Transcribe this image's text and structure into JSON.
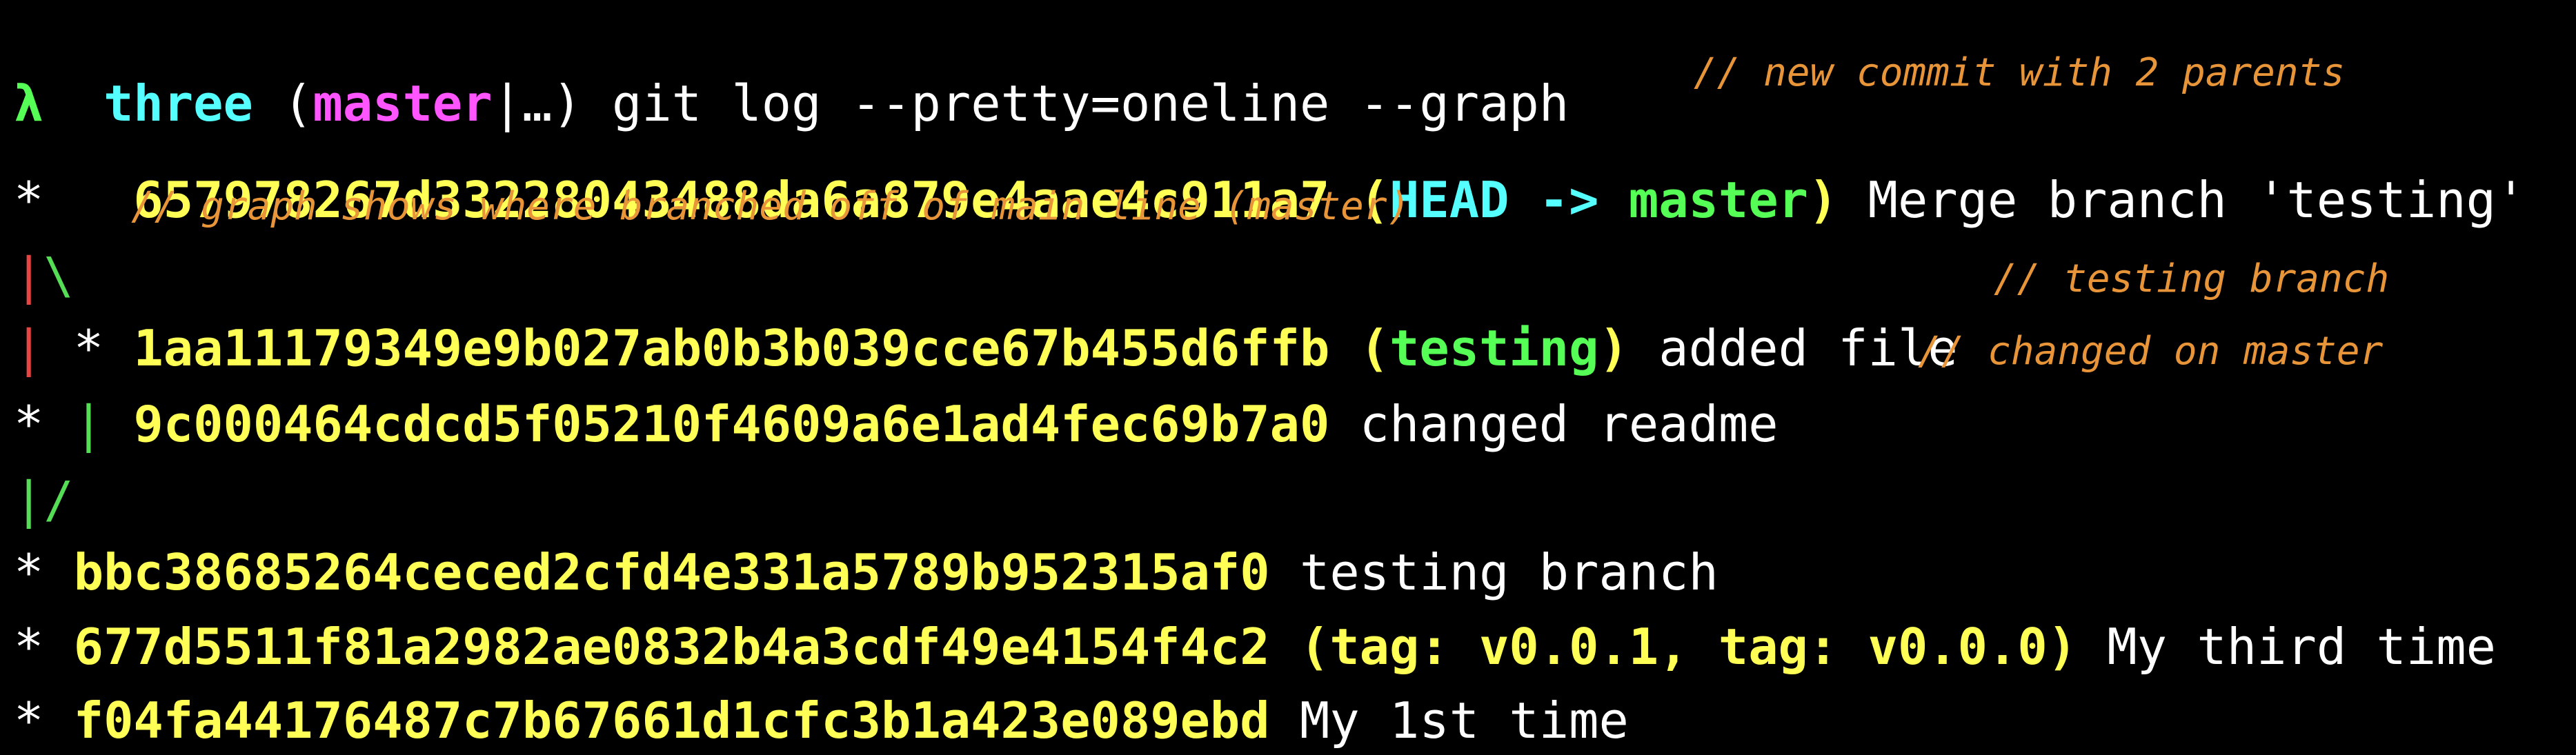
{
  "prompt": {
    "lambda": "λ",
    "directory": "three",
    "open_paren": "(",
    "branch": "master",
    "status": "|…",
    "close_paren": ")",
    "command": "git log --pretty=oneline --graph"
  },
  "annotations": {
    "merge": "// new commit with 2 parents",
    "branched": "// graph shows where branched off of main line (master)",
    "testing": "// testing branch",
    "master": "// changed on master"
  },
  "log": [
    {
      "graph": "*",
      "hash": "657978267d33228043488da6a879e4aae4c911a7",
      "refs_open": "(",
      "ref_head": "HEAD",
      "ref_arrow": "->",
      "ref_branch": "master",
      "refs_close": ")",
      "message": "Merge branch 'testing'"
    },
    {
      "graph_pipe": "|",
      "graph_backslash": "\\"
    },
    {
      "graph_pipe": "|",
      "graph_star": "*",
      "hash": "1aa11179349e9b027ab0b3b039cce67b455d6ffb",
      "refs_open": "(",
      "ref_branch": "testing",
      "refs_close": ")",
      "message": "added file"
    },
    {
      "graph_star": "*",
      "graph_pipe": "|",
      "hash": "9c000464cdcd5f05210f4609a6e1ad4fec69b7a0",
      "message": "changed readme"
    },
    {
      "graph_slash": "|/"
    },
    {
      "graph": "*",
      "hash": "bbc38685264ceced2cfd4e331a5789b952315af0",
      "message": "testing branch"
    },
    {
      "graph": "*",
      "hash": "677d5511f81a2982ae0832b4a3cdf49e4154f4c2",
      "tags": "(tag: v0.0.1, tag: v0.0.0)",
      "message": "My third time"
    },
    {
      "graph": "*",
      "hash": "f04fa44176487c7b67661d1cfc3b1a423e089ebd",
      "message": "My 1st time"
    }
  ],
  "colors": {
    "background": "#000000",
    "hash": "#ffff55",
    "head": "#55ffff",
    "branch": "#55ff55",
    "prompt_branch": "#ff55ff",
    "graph_left": "#e94444",
    "graph_right": "#55dd55",
    "comment": "#e8953a"
  }
}
